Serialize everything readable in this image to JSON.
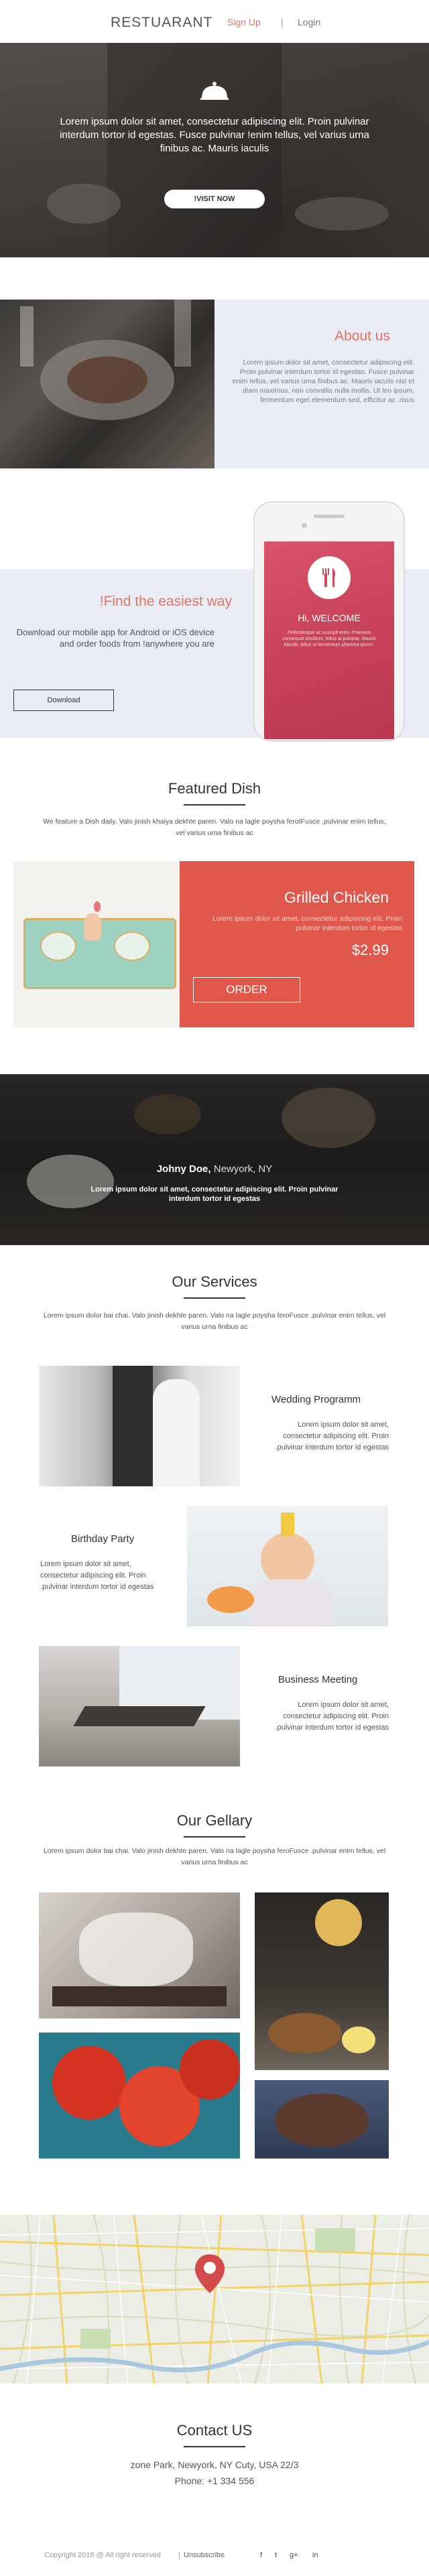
{
  "header": {
    "brand": "RESTUARANT",
    "signup": "Sign Up",
    "separator": "|",
    "login": "Login"
  },
  "hero": {
    "text": "Lorem ipsum dolor sit amet, consectetur adipiscing elit. Proin pulvinar interdum tortor id egestas. Fusce pulvinar !enim tellus, vel varius urna finibus ac. Mauris iaculis",
    "button": "!VISIT NOW"
  },
  "about": {
    "title": "About us",
    "text": "Lorem ipsum dolor sit amet, consectetur adipiscing elit. Proin pulvinar interdum tortor id egestas. Fusce pulvinar enim tellus, vel varius urna finibus ac. Mauris iaculis nisl et diam maximus, non convallis nulla mollis. Ut leo ipsum, fermentum eget elementum sed, efficitur ac .risus"
  },
  "app": {
    "title": "!Find the easiest way",
    "text": "Download our mobile app for Android or iOS device and order foods from !anywhere you are",
    "button": "Download",
    "phone_welcome": "Hi, WELCOME",
    "phone_text": "Pellentesque ac suscipit enim. Praesent consequat tincidunt, tellus at pulvinar. Mauris blandit, tellus ut fermentum pharetra ipsum."
  },
  "featured": {
    "title": "Featured Dish",
    "intro": "We feature a Dish daily. Valo jinish khaiya dekhte paren. Valo na lagle poysha ferotFusce .pulvinar enim tellus, vel varius urna finibus ac",
    "dish_name": "Grilled Chicken",
    "dish_text": "Lorem ipsum dolor sit amet, consectetur adipiscing elit. Proin pulvinar interdum tortor id egestas",
    "price": "$2.99",
    "order_button": "ORDER"
  },
  "testimonial": {
    "name": "Johny Doe,",
    "location": " Newyork, NY",
    "text": "Lorem ipsum dolor sit amet, consectetur adipiscing elit. Proin pulvinar interdum tortor id egestas"
  },
  "services": {
    "title": "Our Services",
    "intro": "Lorem ipsum dolor bai chai. Valo jinish dekhte paren. Valo na lagle poysha feroFusce .pulvinar enim tellus, vel varius urna finibus ac",
    "items": [
      {
        "title": "Wedding Programm",
        "text": "Lorem ipsum dolor sit amet, consectetur adipiscing elit. Proin .pulvinar interdum tortor id egestas"
      },
      {
        "title": "Birthday Party",
        "text": "Lorem ipsum dolor sit amet, consectetur adipiscing elit. Proin .pulvinar interdum tortor id egestas"
      },
      {
        "title": "Business Meeting",
        "text": "Lorem ipsum dolor sit amet, consectetur adipiscing elit. Proin .pulvinar interdum tortor id egestas"
      }
    ]
  },
  "gallery": {
    "title": "Our Gellary",
    "intro": "Lorem ipsum dolor bai chai. Valo jinish dekhte paren. Valo na lagle poysha feroFusce .pulvinar enim tellus, vel varius urna finibus ac"
  },
  "contact": {
    "title": "Contact US",
    "address": "zone Park, Newyork, NY Cuty, USA 22/3",
    "phone": "Phone: +1 334 556"
  },
  "footer": {
    "copyright": "Copyright 2016 @ All right reserved",
    "separator": "|",
    "unsubscribe": "Unsubscribe",
    "social": [
      "f",
      "t",
      "g+",
      "in"
    ]
  },
  "colors": {
    "accent": "#e07560",
    "featured_panel": "#e0574b",
    "band": "#e9ecf5"
  }
}
